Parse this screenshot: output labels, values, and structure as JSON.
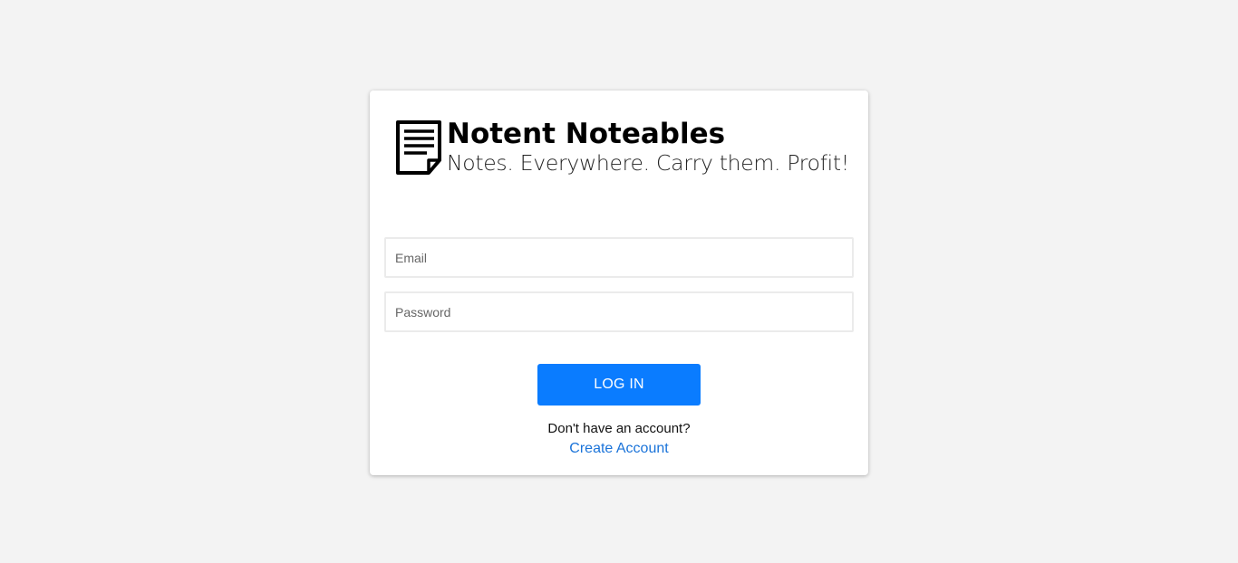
{
  "logo": {
    "title": "Notent Noteables",
    "tagline": "Notes. Everywhere. Carry them. Profit!",
    "icon": "note-page-icon"
  },
  "form": {
    "email_placeholder": "Email",
    "password_placeholder": "Password",
    "login_label": "LOG IN",
    "no_account_text": "Don't have an account?",
    "create_account_label": "Create Account"
  },
  "colors": {
    "background": "#f3f3f3",
    "primary_button": "#0a7cff",
    "link": "#1a73d9"
  }
}
